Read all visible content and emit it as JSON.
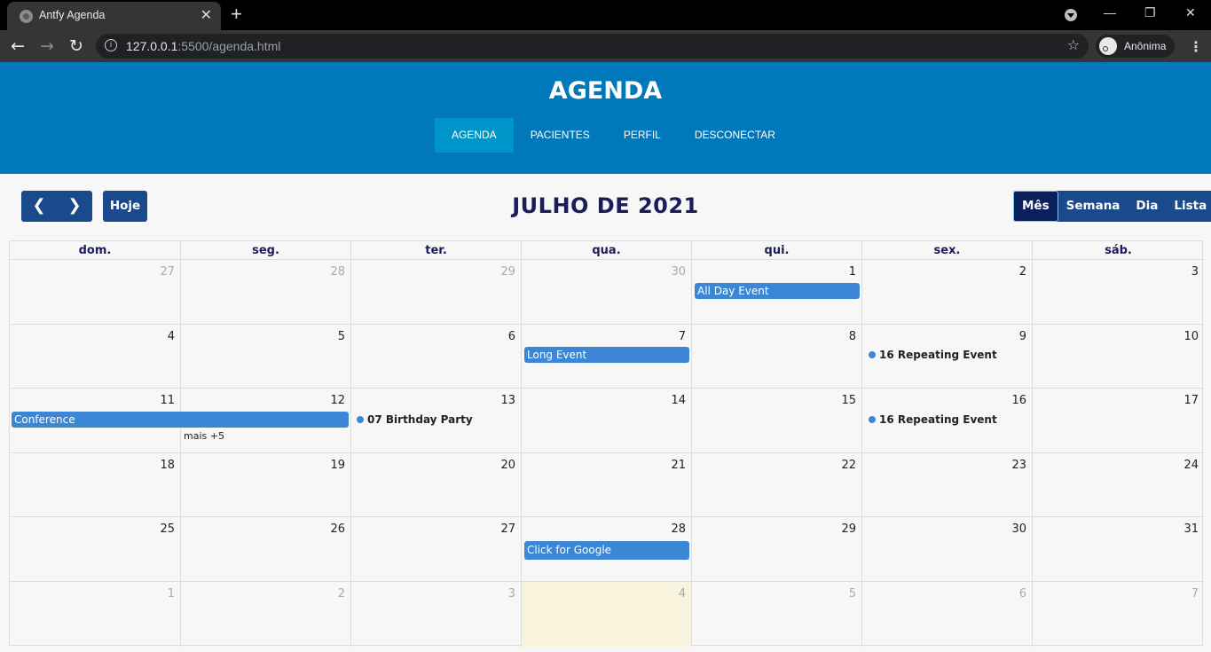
{
  "browser": {
    "tab_title": "Antfy Agenda",
    "tab_close": "✕",
    "new_tab": "+",
    "url_host": "127.0.0.1",
    "url_rest": ":5500/agenda.html",
    "profile_label": "Anônima",
    "minimize": "—",
    "restore": "❐",
    "close": "✕"
  },
  "header": {
    "title": "AGENDA",
    "menu": [
      {
        "label": "AGENDA",
        "active": true
      },
      {
        "label": "PACIENTES"
      },
      {
        "label": "PERFIL"
      },
      {
        "label": "DESCONECTAR"
      }
    ]
  },
  "toolbar": {
    "prev": "‹",
    "next": "›",
    "today": "Hoje",
    "month_title": "JULHO DE 2021",
    "views": [
      "Mês",
      "Semana",
      "Dia",
      "Lista"
    ],
    "active_view": "Mês"
  },
  "calendar": {
    "weekdays": [
      "dom.",
      "seg.",
      "ter.",
      "qua.",
      "qui.",
      "sex.",
      "sáb."
    ],
    "weeks": [
      [
        {
          "d": "27",
          "o": true
        },
        {
          "d": "28",
          "o": true
        },
        {
          "d": "29",
          "o": true
        },
        {
          "d": "30",
          "o": true
        },
        {
          "d": "1"
        },
        {
          "d": "2"
        },
        {
          "d": "3"
        }
      ],
      [
        {
          "d": "4"
        },
        {
          "d": "5"
        },
        {
          "d": "6"
        },
        {
          "d": "7"
        },
        {
          "d": "8"
        },
        {
          "d": "9"
        },
        {
          "d": "10"
        }
      ],
      [
        {
          "d": "11"
        },
        {
          "d": "12"
        },
        {
          "d": "13"
        },
        {
          "d": "14"
        },
        {
          "d": "15"
        },
        {
          "d": "16"
        },
        {
          "d": "17"
        }
      ],
      [
        {
          "d": "18"
        },
        {
          "d": "19"
        },
        {
          "d": "20"
        },
        {
          "d": "21"
        },
        {
          "d": "22"
        },
        {
          "d": "23"
        },
        {
          "d": "24"
        }
      ],
      [
        {
          "d": "25"
        },
        {
          "d": "26"
        },
        {
          "d": "27"
        },
        {
          "d": "28"
        },
        {
          "d": "29"
        },
        {
          "d": "30"
        },
        {
          "d": "31"
        }
      ],
      [
        {
          "d": "1",
          "o": true
        },
        {
          "d": "2",
          "o": true
        },
        {
          "d": "3",
          "o": true
        },
        {
          "d": "4",
          "o": true,
          "today": true
        },
        {
          "d": "5",
          "o": true
        },
        {
          "d": "6",
          "o": true
        },
        {
          "d": "7",
          "o": true
        }
      ]
    ],
    "events": {
      "all_day": "All Day Event",
      "long": "Long Event",
      "repeating_1": {
        "time": "16",
        "title": "Repeating Event"
      },
      "conference": "Conference",
      "more_12": "mais +5",
      "birthday": {
        "time": "07",
        "title": "Birthday Party"
      },
      "repeating_2": {
        "time": "16",
        "title": "Repeating Event"
      },
      "google": "Click for Google"
    },
    "event_color": "#3b87d6"
  }
}
